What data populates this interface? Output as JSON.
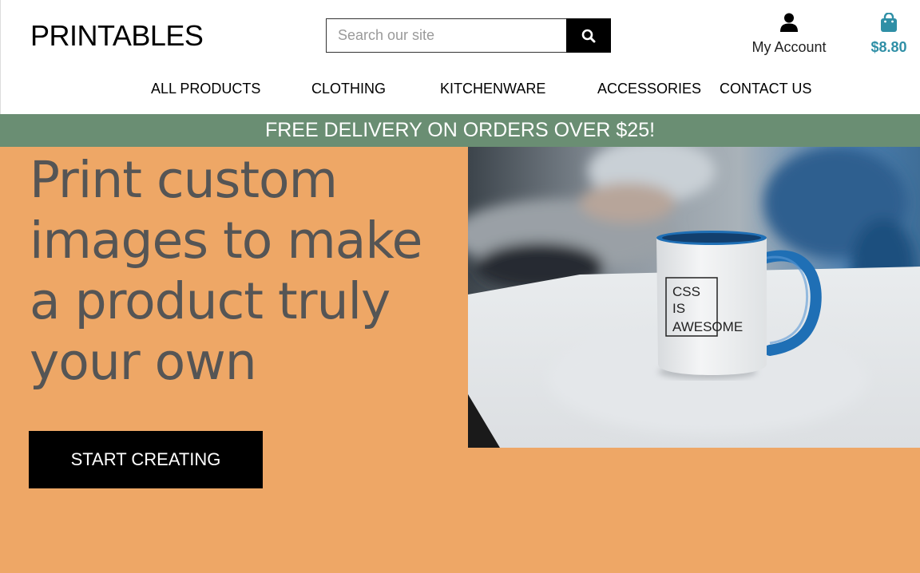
{
  "header": {
    "logo": "PRINTABLES",
    "search": {
      "placeholder": "Search our site"
    },
    "account_label": "My Account",
    "cart_total": "$8.80"
  },
  "nav": {
    "items": [
      {
        "label": "ALL PRODUCTS"
      },
      {
        "label": "CLOTHING"
      },
      {
        "label": "KITCHENWARE"
      },
      {
        "label": "ACCESSORIES"
      },
      {
        "label": "CONTACT US"
      }
    ]
  },
  "banner": {
    "text": "FREE DELIVERY ON ORDERS OVER $25!"
  },
  "hero": {
    "title": "Print custom images to make a product truly your own",
    "cta_label": "START CREATING",
    "mug_text": [
      "CSS",
      "IS",
      "AWESOME"
    ]
  },
  "colors": {
    "banner": "#6a8e73",
    "hero_bg": "#eea766",
    "cart_accent": "#2f8fa6",
    "mug_handle": "#1f6fb5"
  }
}
